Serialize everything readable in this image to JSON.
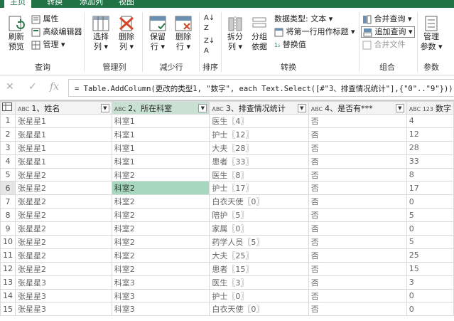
{
  "tabs": [
    "主页",
    "转换",
    "添加列",
    "视图"
  ],
  "ribbon": {
    "query": {
      "refresh": "刷新",
      "refresh2": "预览",
      "properties": "属性",
      "advanced": "高级编辑器",
      "manage": "管理",
      "label": "查询"
    },
    "manage_cols": {
      "choose": "选择",
      "choose2": "列",
      "remove": "删除",
      "remove2": "列",
      "label": "管理列"
    },
    "reduce_rows": {
      "keep": "保留",
      "keep2": "行",
      "remove": "删除",
      "remove2": "行",
      "label": "减少行"
    },
    "sort": {
      "label": "排序"
    },
    "transform": {
      "split": "拆分",
      "split2": "列",
      "group": "分组",
      "group2": "依据",
      "datatype": "数据类型: 文本",
      "firstrow": "将第一行用作标题",
      "replace": "替换值",
      "label": "转换"
    },
    "combine": {
      "merge": "合并查询",
      "append": "追加查询",
      "mergefiles": "合并文件",
      "label": "组合"
    },
    "params": {
      "manage": "管理",
      "manage2": "参数",
      "label": "参数"
    }
  },
  "formula": {
    "text": "= Table.AddColumn(更改的类型1, \"数字\", each Text.Select([#\"3、排查情况统计\"],{\"0\"..\"9\"}))"
  },
  "columns": [
    {
      "type": "ABC",
      "name": "1、姓名"
    },
    {
      "type": "ABC",
      "name": "2、所在科室"
    },
    {
      "type": "ABC",
      "name": "3、排查情况统计"
    },
    {
      "type": "ABC",
      "name": "4、是否有***"
    },
    {
      "type": "ABC 123",
      "name": "数字"
    }
  ],
  "rows": [
    [
      "1",
      "张星星1",
      "科室1",
      "医生〖4〗",
      "否",
      "4"
    ],
    [
      "2",
      "张星星1",
      "科室1",
      "护士〖12〗",
      "否",
      "12"
    ],
    [
      "3",
      "张星星1",
      "科室1",
      "大夫〖28〗",
      "否",
      "28"
    ],
    [
      "4",
      "张星星1",
      "科室1",
      "患者〖33〗",
      "否",
      "33"
    ],
    [
      "5",
      "张星星2",
      "科室2",
      "医生〖8〗",
      "否",
      "8"
    ],
    [
      "6",
      "张星星2",
      "科室2",
      "护士〖17〗",
      "否",
      "17"
    ],
    [
      "7",
      "张星星2",
      "科室2",
      "白衣天使〖0〗",
      "否",
      "0"
    ],
    [
      "8",
      "张星星2",
      "科室2",
      "陪护〖5〗",
      "否",
      "5"
    ],
    [
      "9",
      "张星星2",
      "科室2",
      "家属〖0〗",
      "否",
      "0"
    ],
    [
      "10",
      "张星星2",
      "科室2",
      "药学人员〖5〗",
      "否",
      "5"
    ],
    [
      "11",
      "张星星2",
      "科室2",
      "大夫〖25〗",
      "否",
      "25"
    ],
    [
      "12",
      "张星星2",
      "科室2",
      "患者〖15〗",
      "否",
      "15"
    ],
    [
      "13",
      "张星星3",
      "科室3",
      "医生〖3〗",
      "否",
      "3"
    ],
    [
      "14",
      "张星星3",
      "科室3",
      "护士〖0〗",
      "否",
      "0"
    ],
    [
      "15",
      "张星星3",
      "科室3",
      "白衣天使〖0〗",
      "否",
      "0"
    ]
  ]
}
